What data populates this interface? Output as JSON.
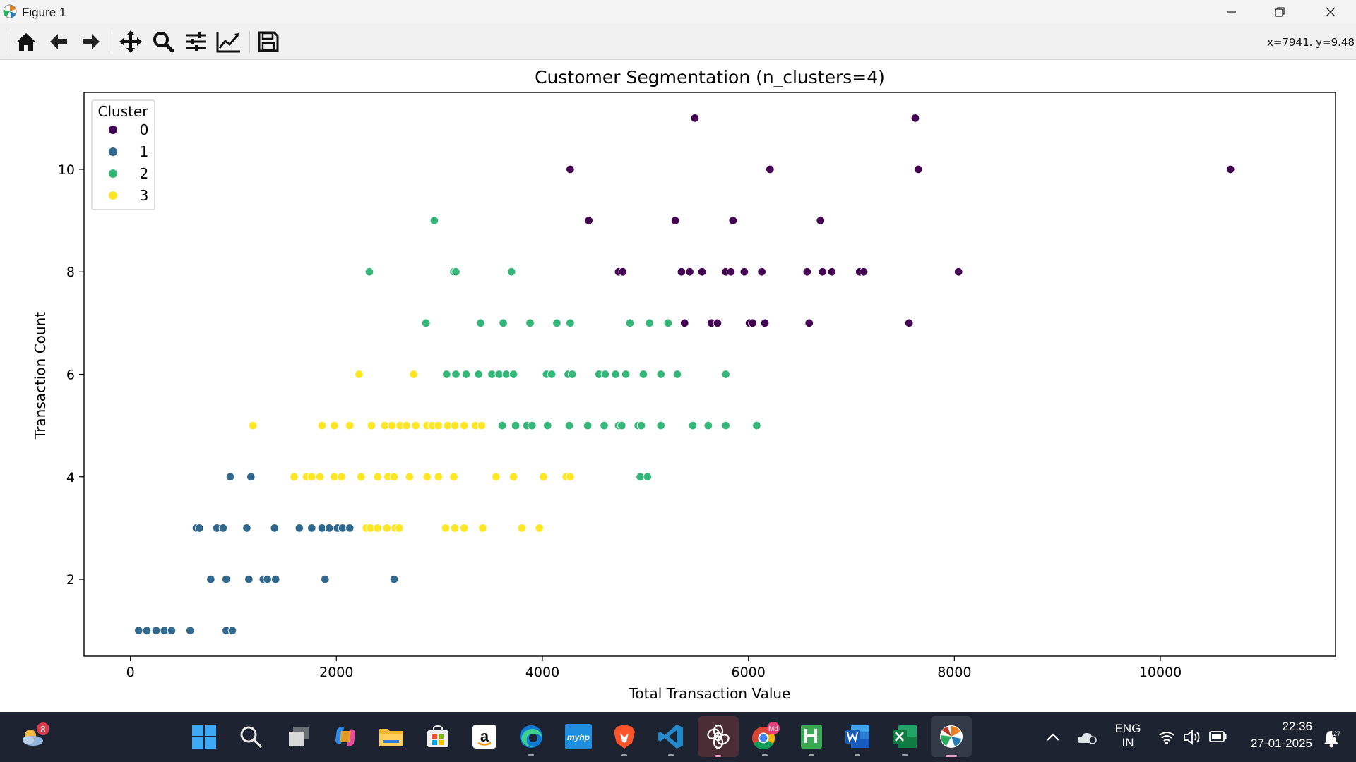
{
  "window": {
    "title": "Figure 1"
  },
  "toolbar": {
    "buttons": [
      "home-icon",
      "back-icon",
      "forward-icon",
      "pan-icon",
      "zoom-icon",
      "configure-subplots-icon",
      "edit-axis-icon",
      "save-icon"
    ],
    "coords": "x=7941. y=9.48"
  },
  "chart_data": {
    "type": "scatter",
    "title": "Customer Segmentation (n_clusters=4)",
    "xlabel": "Total Transaction Value",
    "ylabel": "Transaction Count",
    "xlim": [
      -450,
      11700
    ],
    "ylim": [
      0.5,
      11.5
    ],
    "xticks": [
      0,
      2000,
      4000,
      6000,
      8000,
      10000
    ],
    "yticks": [
      2,
      4,
      6,
      8,
      10
    ],
    "xtick_labels": [
      "0",
      "2000",
      "4000",
      "6000",
      "8000",
      "10000"
    ],
    "ytick_labels": [
      "2",
      "4",
      "6",
      "8",
      "10"
    ],
    "grid": false,
    "legend": {
      "title": "Cluster",
      "position": "top-left",
      "entries": [
        "0",
        "1",
        "2",
        "3"
      ]
    },
    "series": [
      {
        "name": "0",
        "color": "#440154",
        "points": [
          [
            5480,
            11
          ],
          [
            7620,
            11
          ],
          [
            4270,
            10
          ],
          [
            6210,
            10
          ],
          [
            7650,
            10
          ],
          [
            10680,
            10
          ],
          [
            4450,
            9
          ],
          [
            5290,
            9
          ],
          [
            5850,
            9
          ],
          [
            6700,
            9
          ],
          [
            4740,
            8
          ],
          [
            4780,
            8
          ],
          [
            5350,
            8
          ],
          [
            5430,
            8
          ],
          [
            5550,
            8
          ],
          [
            5780,
            8
          ],
          [
            5830,
            8
          ],
          [
            5960,
            8
          ],
          [
            6130,
            8
          ],
          [
            6570,
            8
          ],
          [
            6720,
            8
          ],
          [
            6810,
            8
          ],
          [
            7080,
            8
          ],
          [
            7120,
            8
          ],
          [
            8040,
            8
          ],
          [
            5380,
            7
          ],
          [
            5640,
            7
          ],
          [
            5700,
            7
          ],
          [
            6010,
            7
          ],
          [
            6040,
            7
          ],
          [
            6160,
            7
          ],
          [
            6590,
            7
          ],
          [
            7560,
            7
          ]
        ]
      },
      {
        "name": "1",
        "color": "#31688e",
        "points": [
          [
            970,
            4
          ],
          [
            1170,
            4
          ],
          [
            640,
            3
          ],
          [
            670,
            3
          ],
          [
            840,
            3
          ],
          [
            900,
            3
          ],
          [
            1130,
            3
          ],
          [
            1400,
            3
          ],
          [
            1640,
            3
          ],
          [
            1760,
            3
          ],
          [
            1860,
            3
          ],
          [
            1930,
            3
          ],
          [
            2010,
            3
          ],
          [
            2060,
            3
          ],
          [
            2130,
            3
          ],
          [
            780,
            2
          ],
          [
            930,
            2
          ],
          [
            1150,
            2
          ],
          [
            1290,
            2
          ],
          [
            1330,
            2
          ],
          [
            1410,
            2
          ],
          [
            1890,
            2
          ],
          [
            2560,
            2
          ],
          [
            80,
            1
          ],
          [
            160,
            1
          ],
          [
            250,
            1
          ],
          [
            330,
            1
          ],
          [
            400,
            1
          ],
          [
            580,
            1
          ],
          [
            930,
            1
          ],
          [
            990,
            1
          ]
        ]
      },
      {
        "name": "2",
        "color": "#35b779",
        "points": [
          [
            2950,
            9
          ],
          [
            2320,
            8
          ],
          [
            3140,
            8
          ],
          [
            3160,
            8
          ],
          [
            3700,
            8
          ],
          [
            2870,
            7
          ],
          [
            3400,
            7
          ],
          [
            3620,
            7
          ],
          [
            3880,
            7
          ],
          [
            4140,
            7
          ],
          [
            4270,
            7
          ],
          [
            4850,
            7
          ],
          [
            5040,
            7
          ],
          [
            5220,
            7
          ],
          [
            3070,
            6
          ],
          [
            3160,
            6
          ],
          [
            3260,
            6
          ],
          [
            3380,
            6
          ],
          [
            3510,
            6
          ],
          [
            3580,
            6
          ],
          [
            3650,
            6
          ],
          [
            3720,
            6
          ],
          [
            4040,
            6
          ],
          [
            4090,
            6
          ],
          [
            4250,
            6
          ],
          [
            4290,
            6
          ],
          [
            4550,
            6
          ],
          [
            4610,
            6
          ],
          [
            4710,
            6
          ],
          [
            4810,
            6
          ],
          [
            4980,
            6
          ],
          [
            5150,
            6
          ],
          [
            5310,
            6
          ],
          [
            5780,
            6
          ],
          [
            3610,
            5
          ],
          [
            3740,
            5
          ],
          [
            3850,
            5
          ],
          [
            3900,
            5
          ],
          [
            4050,
            5
          ],
          [
            4260,
            5
          ],
          [
            4440,
            5
          ],
          [
            4600,
            5
          ],
          [
            4740,
            5
          ],
          [
            4770,
            5
          ],
          [
            4930,
            5
          ],
          [
            4960,
            5
          ],
          [
            5150,
            5
          ],
          [
            5460,
            5
          ],
          [
            5610,
            5
          ],
          [
            5780,
            5
          ],
          [
            6080,
            5
          ],
          [
            4950,
            4
          ],
          [
            5020,
            4
          ]
        ]
      },
      {
        "name": "3",
        "color": "#fde725",
        "points": [
          [
            2220,
            6
          ],
          [
            2750,
            6
          ],
          [
            1190,
            5
          ],
          [
            1860,
            5
          ],
          [
            1980,
            5
          ],
          [
            2130,
            5
          ],
          [
            2340,
            5
          ],
          [
            2470,
            5
          ],
          [
            2540,
            5
          ],
          [
            2620,
            5
          ],
          [
            2680,
            5
          ],
          [
            2770,
            5
          ],
          [
            2880,
            5
          ],
          [
            2930,
            5
          ],
          [
            2990,
            5
          ],
          [
            3080,
            5
          ],
          [
            3150,
            5
          ],
          [
            3240,
            5
          ],
          [
            3350,
            5
          ],
          [
            3410,
            5
          ],
          [
            1590,
            4
          ],
          [
            1710,
            4
          ],
          [
            1760,
            4
          ],
          [
            1840,
            4
          ],
          [
            1980,
            4
          ],
          [
            2050,
            4
          ],
          [
            2240,
            4
          ],
          [
            2400,
            4
          ],
          [
            2500,
            4
          ],
          [
            2560,
            4
          ],
          [
            2710,
            4
          ],
          [
            2880,
            4
          ],
          [
            2990,
            4
          ],
          [
            3140,
            4
          ],
          [
            3550,
            4
          ],
          [
            3720,
            4
          ],
          [
            4010,
            4
          ],
          [
            4230,
            4
          ],
          [
            4270,
            4
          ],
          [
            2290,
            3
          ],
          [
            2330,
            3
          ],
          [
            2400,
            3
          ],
          [
            2490,
            3
          ],
          [
            2570,
            3
          ],
          [
            2610,
            3
          ],
          [
            3060,
            3
          ],
          [
            3150,
            3
          ],
          [
            3240,
            3
          ],
          [
            3420,
            3
          ],
          [
            3800,
            3
          ],
          [
            3970,
            3
          ]
        ]
      }
    ]
  },
  "taskbar": {
    "weather_badge": "8",
    "apps": [
      "start-icon",
      "search-icon",
      "task-view-icon",
      "copilot-icon",
      "file-explorer-icon",
      "microsoft-store-icon",
      "amazon-icon",
      "edge-icon",
      "myhp-icon",
      "brave-icon",
      "vscode-icon",
      "chatgpt-icon",
      "chrome-icon",
      "h-app-icon",
      "word-icon",
      "excel-icon",
      "python-figure-icon"
    ],
    "myhp_label": "myhp",
    "amazon_label": "a",
    "chrome_badge": "Md",
    "lang_line1": "ENG",
    "lang_line2": "IN",
    "time": "22:36",
    "date": "27-01-2025",
    "notif_badge": "27"
  }
}
